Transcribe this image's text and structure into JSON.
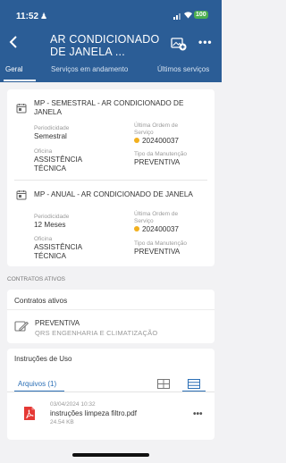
{
  "status_bar": {
    "time": "11:52",
    "battery": "100",
    "signal_icon": "signal-bars-icon",
    "wifi_icon": "wifi-icon",
    "person_icon": "person-icon"
  },
  "header": {
    "back_icon": "chevron-left-icon",
    "title": "AR CONDICIONADO DE JANELA ...",
    "action_icon": "add-image-icon",
    "more_label": "•••",
    "background": "#2b5d96"
  },
  "tabs": [
    {
      "label": "Geral",
      "active": true
    },
    {
      "label": "Serviços em andamento",
      "active": false
    },
    {
      "label": "Últimos serviços",
      "active": false
    }
  ],
  "plans": [
    {
      "title": "MP - SEMESTRAL - AR CONDICIONADO DE JANELA",
      "icon": "calendar-icon",
      "periodicidade_label": "Periodicidade",
      "periodicidade": "Semestral",
      "ultima_os_label": "Última Ordem de Serviço",
      "ultima_os": "202400037",
      "oficina_label": "Oficina",
      "oficina": "ASSISTÊNCIA TÉCNICA",
      "tipo_label": "Tipo da Manutenção",
      "tipo": "PREVENTIVA"
    },
    {
      "title": "MP - ANUAL - AR CONDICIONADO DE JANELA",
      "icon": "calendar-icon",
      "periodicidade_label": "Periodicidade",
      "periodicidade": "12 Meses",
      "ultima_os_label": "Última Ordem de Serviço",
      "ultima_os": "202400037",
      "oficina_label": "Oficina",
      "oficina": "ASSISTÊNCIA TÉCNICA",
      "tipo_label": "Tipo da Manutenção",
      "tipo": "PREVENTIVA"
    }
  ],
  "contracts": {
    "section_label": "CONTRATOS ATIVOS",
    "title": "Contratos ativos",
    "items": [
      {
        "type": "PREVENTIVA",
        "company": "QRS ENGENHARIA E CLIMATIZAÇÃO",
        "icon": "contract-edit-icon"
      }
    ]
  },
  "instructions": {
    "title": "Instruções de Uso",
    "tab_label": "Arquivos (1)",
    "view_icons": [
      "grid-view-icon",
      "list-view-icon"
    ],
    "files": [
      {
        "date": "03/04/2024 10:32",
        "name": "instruções limpeza filtro.pdf",
        "size": "24.54 KB",
        "icon": "pdf-file-icon",
        "more": "•••"
      }
    ]
  },
  "colors": {
    "accent": "#2b6fb6",
    "status_dot": "#f2b01e",
    "pdf": "#e53935"
  }
}
